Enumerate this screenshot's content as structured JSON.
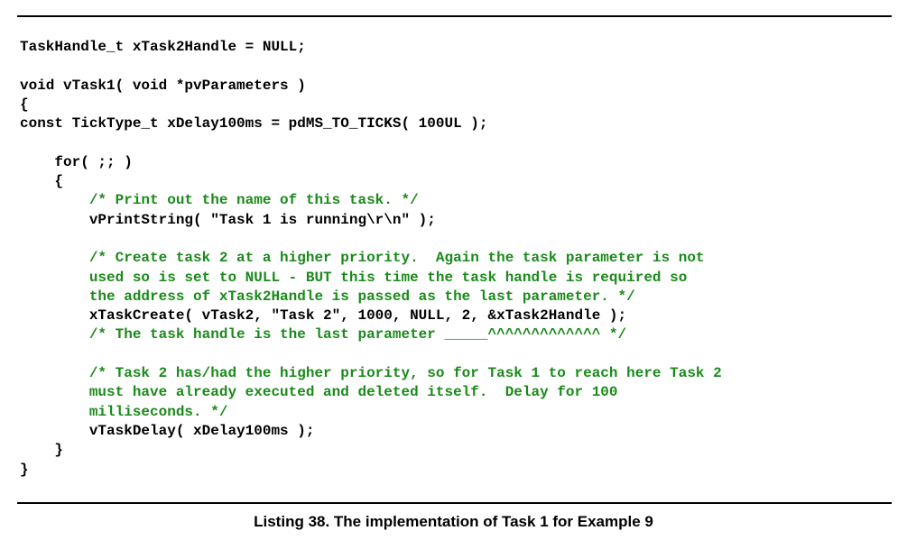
{
  "colors": {
    "code": "#000000",
    "comment": "#1a8a1a",
    "rule": "#000000"
  },
  "code_lines": [
    {
      "text": "TaskHandle_t xTask2Handle = NULL;",
      "comment": false
    },
    {
      "text": "",
      "comment": false
    },
    {
      "text": "void vTask1( void *pvParameters )",
      "comment": false
    },
    {
      "text": "{",
      "comment": false
    },
    {
      "text": "const TickType_t xDelay100ms = pdMS_TO_TICKS( 100UL );",
      "comment": false
    },
    {
      "text": "",
      "comment": false
    },
    {
      "text": "    for( ;; )",
      "comment": false
    },
    {
      "text": "    {",
      "comment": false
    },
    {
      "text": "        /* Print out the name of this task. */",
      "comment": true
    },
    {
      "text": "        vPrintString( \"Task 1 is running\\r\\n\" );",
      "comment": false
    },
    {
      "text": "",
      "comment": false
    },
    {
      "text": "        /* Create task 2 at a higher priority.  Again the task parameter is not",
      "comment": true
    },
    {
      "text": "        used so is set to NULL - BUT this time the task handle is required so",
      "comment": true
    },
    {
      "text": "        the address of xTask2Handle is passed as the last parameter. */",
      "comment": true
    },
    {
      "text": "        xTaskCreate( vTask2, \"Task 2\", 1000, NULL, 2, &xTask2Handle );",
      "comment": false
    },
    {
      "text": "        /* The task handle is the last parameter _____^^^^^^^^^^^^^ */",
      "comment": true
    },
    {
      "text": "",
      "comment": false
    },
    {
      "text": "        /* Task 2 has/had the higher priority, so for Task 1 to reach here Task 2",
      "comment": true
    },
    {
      "text": "        must have already executed and deleted itself.  Delay for 100",
      "comment": true
    },
    {
      "text": "        milliseconds. */",
      "comment": true
    },
    {
      "text": "        vTaskDelay( xDelay100ms );",
      "comment": false
    },
    {
      "text": "    }",
      "comment": false
    },
    {
      "text": "}",
      "comment": false
    }
  ],
  "caption": "Listing 38.  The implementation of Task 1 for Example 9"
}
